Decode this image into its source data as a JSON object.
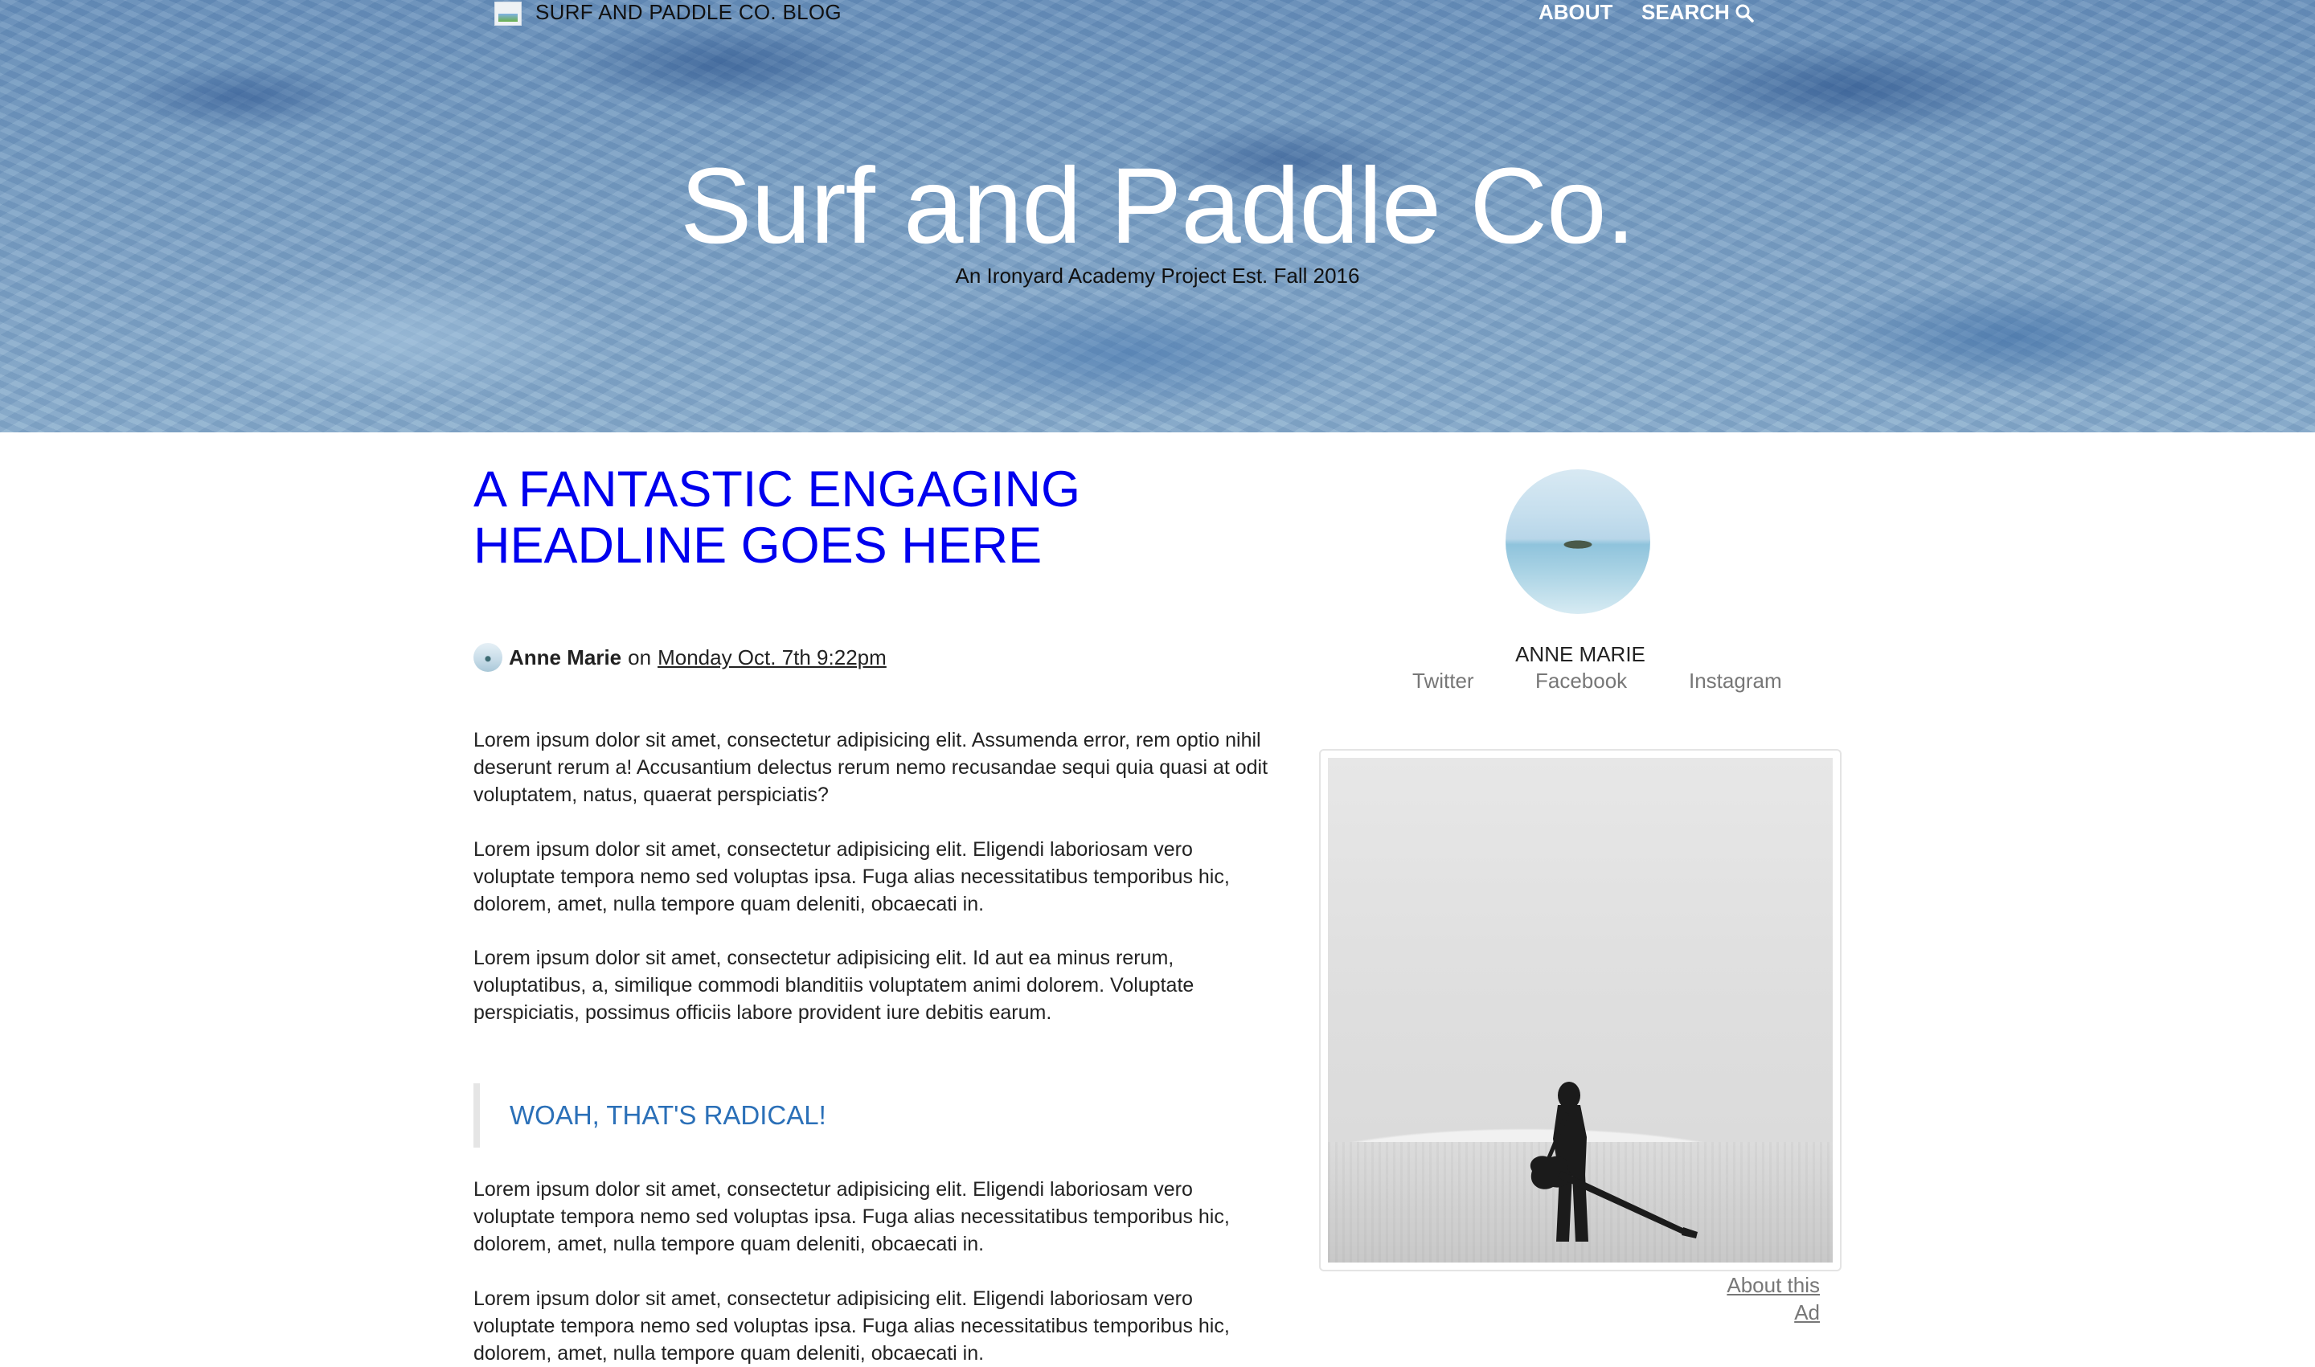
{
  "nav": {
    "brand": "SURF AND PADDLE CO. BLOG",
    "about": "ABOUT",
    "search": "SEARCH"
  },
  "hero": {
    "title": "Surf and Paddle Co.",
    "subtitle": "An Ironyard Academy Project Est. Fall 2016"
  },
  "article": {
    "headline": "A FANTASTIC ENGAGING HEADLINE GOES HERE",
    "author": "Anne Marie",
    "on": "on",
    "date": "Monday Oct. 7th 9:22pm",
    "paragraphs": [
      "Lorem ipsum dolor sit amet, consectetur adipisicing elit. Assumenda error, rem optio nihil deserunt rerum a! Accusantium delectus rerum nemo recusandae sequi quia quasi at odit voluptatem, natus, quaerat perspiciatis?",
      "Lorem ipsum dolor sit amet, consectetur adipisicing elit. Eligendi laboriosam vero voluptate tempora nemo sed voluptas ipsa. Fuga alias necessitatibus temporibus hic, dolorem, amet, nulla tempore quam deleniti, obcaecati in.",
      "Lorem ipsum dolor sit amet, consectetur adipisicing elit. Id aut ea minus rerum, voluptatibus, a, similique commodi blanditiis voluptatem animi dolorem. Voluptate perspiciatis, possimus officiis labore provident iure debitis earum.",
      "Lorem ipsum dolor sit amet, consectetur adipisicing elit. Eligendi laboriosam vero voluptate tempora nemo sed voluptas ipsa. Fuga alias necessitatibus temporibus hic, dolorem, amet, nulla tempore quam deleniti, obcaecati in.",
      "Lorem ipsum dolor sit amet, consectetur adipisicing elit. Eligendi laboriosam vero voluptate tempora nemo sed voluptas ipsa. Fuga alias necessitatibus temporibus hic, dolorem, amet, nulla tempore quam deleniti, obcaecati in."
    ],
    "blockquote": "WOAH, THAT'S RADICAL!"
  },
  "sidebar": {
    "name": "ANNE MARIE",
    "social": [
      "Twitter",
      "Facebook",
      "Instagram"
    ],
    "ad_link": "About this Ad"
  },
  "colors": {
    "headline": "#0000ee",
    "quote": "#2b70b8",
    "social": "#777777"
  },
  "icons": {
    "search": "search-icon",
    "logo": "broken-image-icon"
  }
}
